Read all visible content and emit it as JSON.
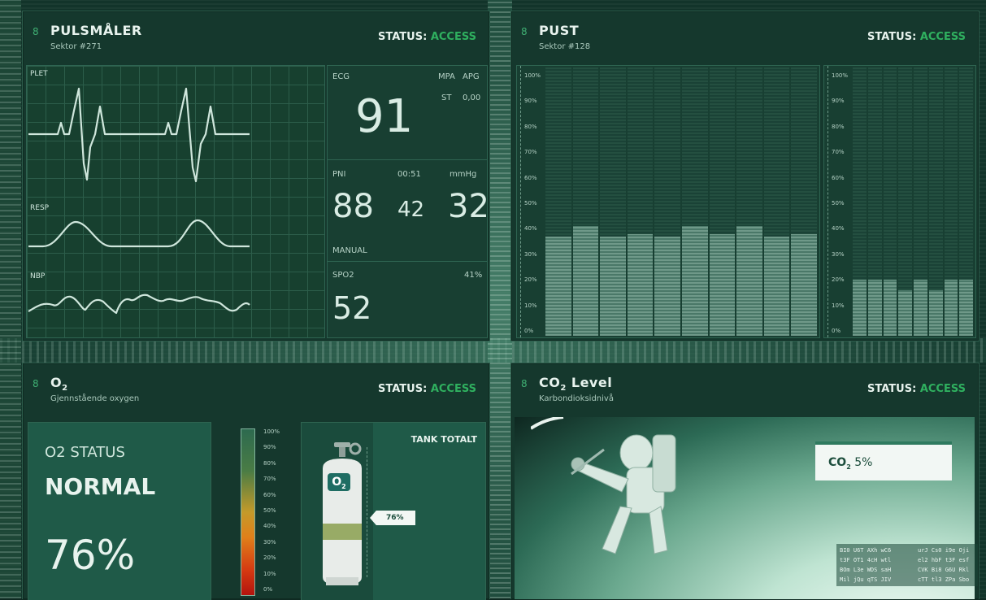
{
  "status_label": "STATUS: ",
  "status_value": "ACCESS",
  "panels": {
    "pulse": {
      "num": "8",
      "title": "PULSMÅLER",
      "subtitle": "Sektor #271"
    },
    "breath": {
      "num": "8",
      "title": "PUST",
      "subtitle": "Sektor #128"
    },
    "o2": {
      "num": "8",
      "title": "O",
      "title_sub": "2",
      "subtitle": "Gjennstående oxygen"
    },
    "co2": {
      "num": "8",
      "title": "CO",
      "title_sub": "2",
      "title_rest": " Level",
      "subtitle": "Karbondioksidnivå"
    }
  },
  "monitor": {
    "waves": [
      "PLET",
      "RESP",
      "NBP"
    ],
    "ecg_label": "ECG",
    "ecg_value": "91",
    "mpa": "MPA",
    "apg": "APG",
    "st": "ST",
    "st_value": "0,00",
    "pni_label": "PNI",
    "pni_time": "00:51",
    "pni_unit": "mmHg",
    "pni_sys": "88",
    "pni_mid": "42",
    "pni_dia": "32",
    "manual": "MANUAL",
    "spo2_label": "SPO2",
    "spo2_pct": "41%",
    "spo2_value": "52"
  },
  "breath_chart": {
    "ticks": [
      "100%",
      "90%",
      "80%",
      "70%",
      "60%",
      "50%",
      "40%",
      "30%",
      "20%",
      "10%",
      "0%"
    ],
    "left_values": [
      37,
      41,
      37,
      38,
      37,
      41,
      38,
      41,
      37,
      38
    ],
    "right_values": [
      21,
      21,
      21,
      17,
      21,
      17,
      21,
      21
    ]
  },
  "o2": {
    "status_label": "O2 STATUS",
    "status_value": "NORMAL",
    "percent": "76%",
    "gauge_ticks": [
      "100%",
      "90%",
      "80%",
      "70%",
      "60%",
      "50%",
      "40%",
      "30%",
      "20%",
      "10%",
      "0%"
    ],
    "tank_label": "TANK TOTALT",
    "tank_icon_text": "O",
    "tank_icon_sub": "2",
    "tank_pointer": "76%",
    "level": 0.76
  },
  "co2": {
    "label": "CO",
    "label_sub": "2",
    "value": " 5%",
    "codes_left": [
      "BI0  U6T  AXh  wC6",
      "t3F  OT1  4cH  wtl",
      "BOm  L3e  WDS  saH",
      "Mil  jQu  qTS  JIV"
    ],
    "codes_right": [
      "urJ  Cs0  i9e  Oji",
      "el2  hbF  t3F  esf",
      "CVK  Bi8  G6U  Rkl",
      "cTT  tl3  ZPa  Sbo"
    ]
  },
  "colors": {
    "accent": "#2fb05f",
    "panel": "#15382d"
  }
}
